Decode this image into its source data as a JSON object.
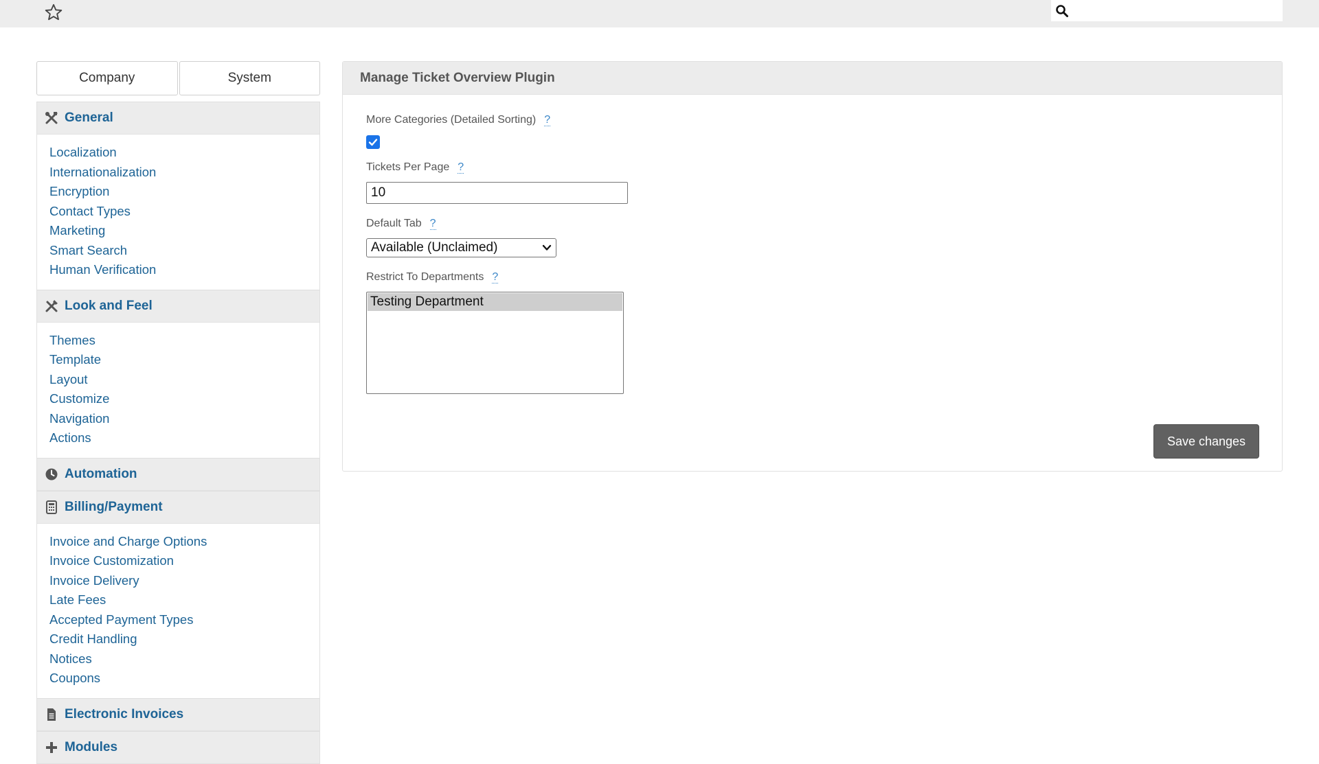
{
  "topbar": {
    "favorite_icon": "star-outline-icon",
    "search": {
      "icon": "search-icon",
      "value": ""
    }
  },
  "sidebar": {
    "tabs": [
      {
        "label": "Company"
      },
      {
        "label": "System"
      }
    ],
    "sections": [
      {
        "title": "General",
        "icon": "tools-icon",
        "links": [
          "Localization",
          "Internationalization",
          "Encryption",
          "Contact Types",
          "Marketing",
          "Smart Search",
          "Human Verification"
        ]
      },
      {
        "title": "Look and Feel",
        "icon": "paint-tools-icon",
        "links": [
          "Themes",
          "Template",
          "Layout",
          "Customize",
          "Navigation",
          "Actions"
        ]
      },
      {
        "title": "Automation",
        "icon": "clock-icon",
        "links": []
      },
      {
        "title": "Billing/Payment",
        "icon": "calculator-icon",
        "links": [
          "Invoice and Charge Options",
          "Invoice Customization",
          "Invoice Delivery",
          "Late Fees",
          "Accepted Payment Types",
          "Credit Handling",
          "Notices",
          "Coupons"
        ]
      },
      {
        "title": "Electronic Invoices",
        "icon": "document-icon",
        "links": []
      },
      {
        "title": "Modules",
        "icon": "plus-icon",
        "links": []
      }
    ]
  },
  "panel": {
    "title": "Manage Ticket Overview Plugin",
    "fields": {
      "more_categories": {
        "label": "More Categories (Detailed Sorting)",
        "help": "?",
        "checked": true
      },
      "tickets_per_page": {
        "label": "Tickets Per Page",
        "help": "?",
        "value": "10"
      },
      "default_tab": {
        "label": "Default Tab",
        "help": "?",
        "selected": "Available (Unclaimed)"
      },
      "restrict_departments": {
        "label": "Restrict To Departments",
        "help": "?",
        "options": [
          "Testing Department"
        ]
      }
    },
    "save_label": "Save changes"
  },
  "colors": {
    "link": "#1e6496",
    "header_bg": "#ececec",
    "button_bg": "#616161",
    "checkbox": "#1a73e8"
  }
}
